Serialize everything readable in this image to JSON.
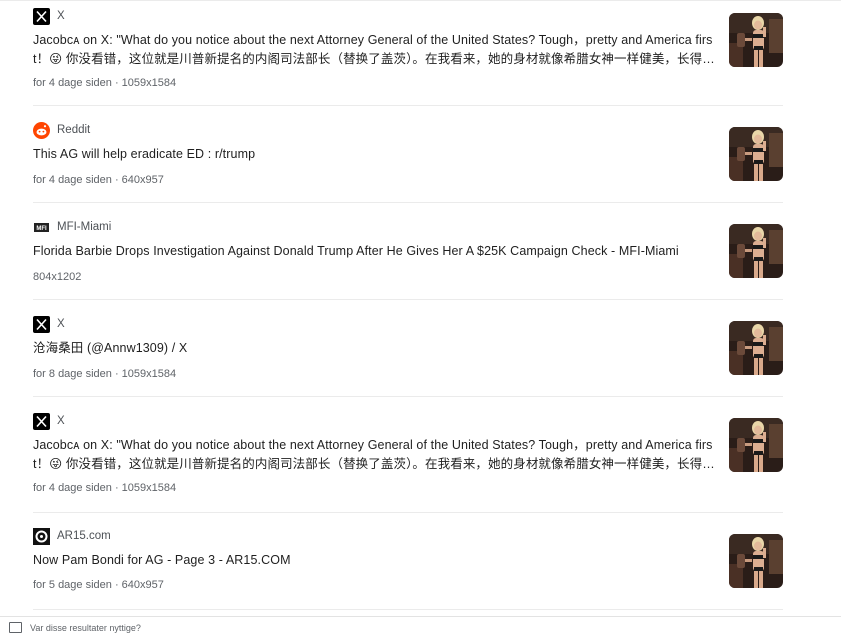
{
  "results": [
    {
      "source": "X",
      "favicon": "x-logo-icon",
      "title": "Jacobᴄᴀ on X: \"What do you notice about the next Attorney General of the United States? Tough，pretty and America first！😜 你没看错，这位就是川普新提名的内阁司法部长（替换了盖茨）。在我看来，她的身材就像希腊女神一样健美，长得甚…",
      "meta": "for 4 dage siden · 1059x1584",
      "thumbnail": "woman-bikini-photo"
    },
    {
      "source": "Reddit",
      "favicon": "reddit-logo-icon",
      "title": "This AG will help eradicate ED : r/trump",
      "meta": "for 4 dage siden · 640x957",
      "thumbnail": "woman-bikini-photo"
    },
    {
      "source": "MFI-Miami",
      "favicon": "mfi-miami-logo-icon",
      "title": "Florida Barbie Drops Investigation Against Donald Trump After He Gives Her A $25K Campaign Check - MFI-Miami",
      "meta": "804x1202",
      "thumbnail": "woman-bikini-photo"
    },
    {
      "source": "X",
      "favicon": "x-logo-icon",
      "title": "沧海桑田 (@Annw1309) / X",
      "meta": "for 8 dage siden · 1059x1584",
      "thumbnail": "woman-bikini-photo"
    },
    {
      "source": "X",
      "favicon": "x-logo-icon",
      "title": "Jacobᴄᴀ on X: \"What do you notice about the next Attorney General of the United States? Tough，pretty and America first！😜 你没看错，这位就是川普新提名的内阁司法部长（替换了盖茨）。在我看来，她的身材就像希腊女神一样健美，长得甚…",
      "meta": "for 4 dage siden · 1059x1584",
      "thumbnail": "woman-bikini-photo"
    },
    {
      "source": "AR15.com",
      "favicon": "ar15-logo-icon",
      "title": "Now Pam Bondi for AG - Page 3 - AR15.COM",
      "meta": "for 5 dage siden · 640x957",
      "thumbnail": "woman-bikini-photo"
    }
  ],
  "footer": {
    "icon": "feedback-icon",
    "text": "Var disse resultater nyttige?"
  },
  "colors": {
    "title": "#1f1f1f",
    "meta": "#5f6368",
    "separator": "#ebebeb",
    "reddit": "#ff4500"
  }
}
